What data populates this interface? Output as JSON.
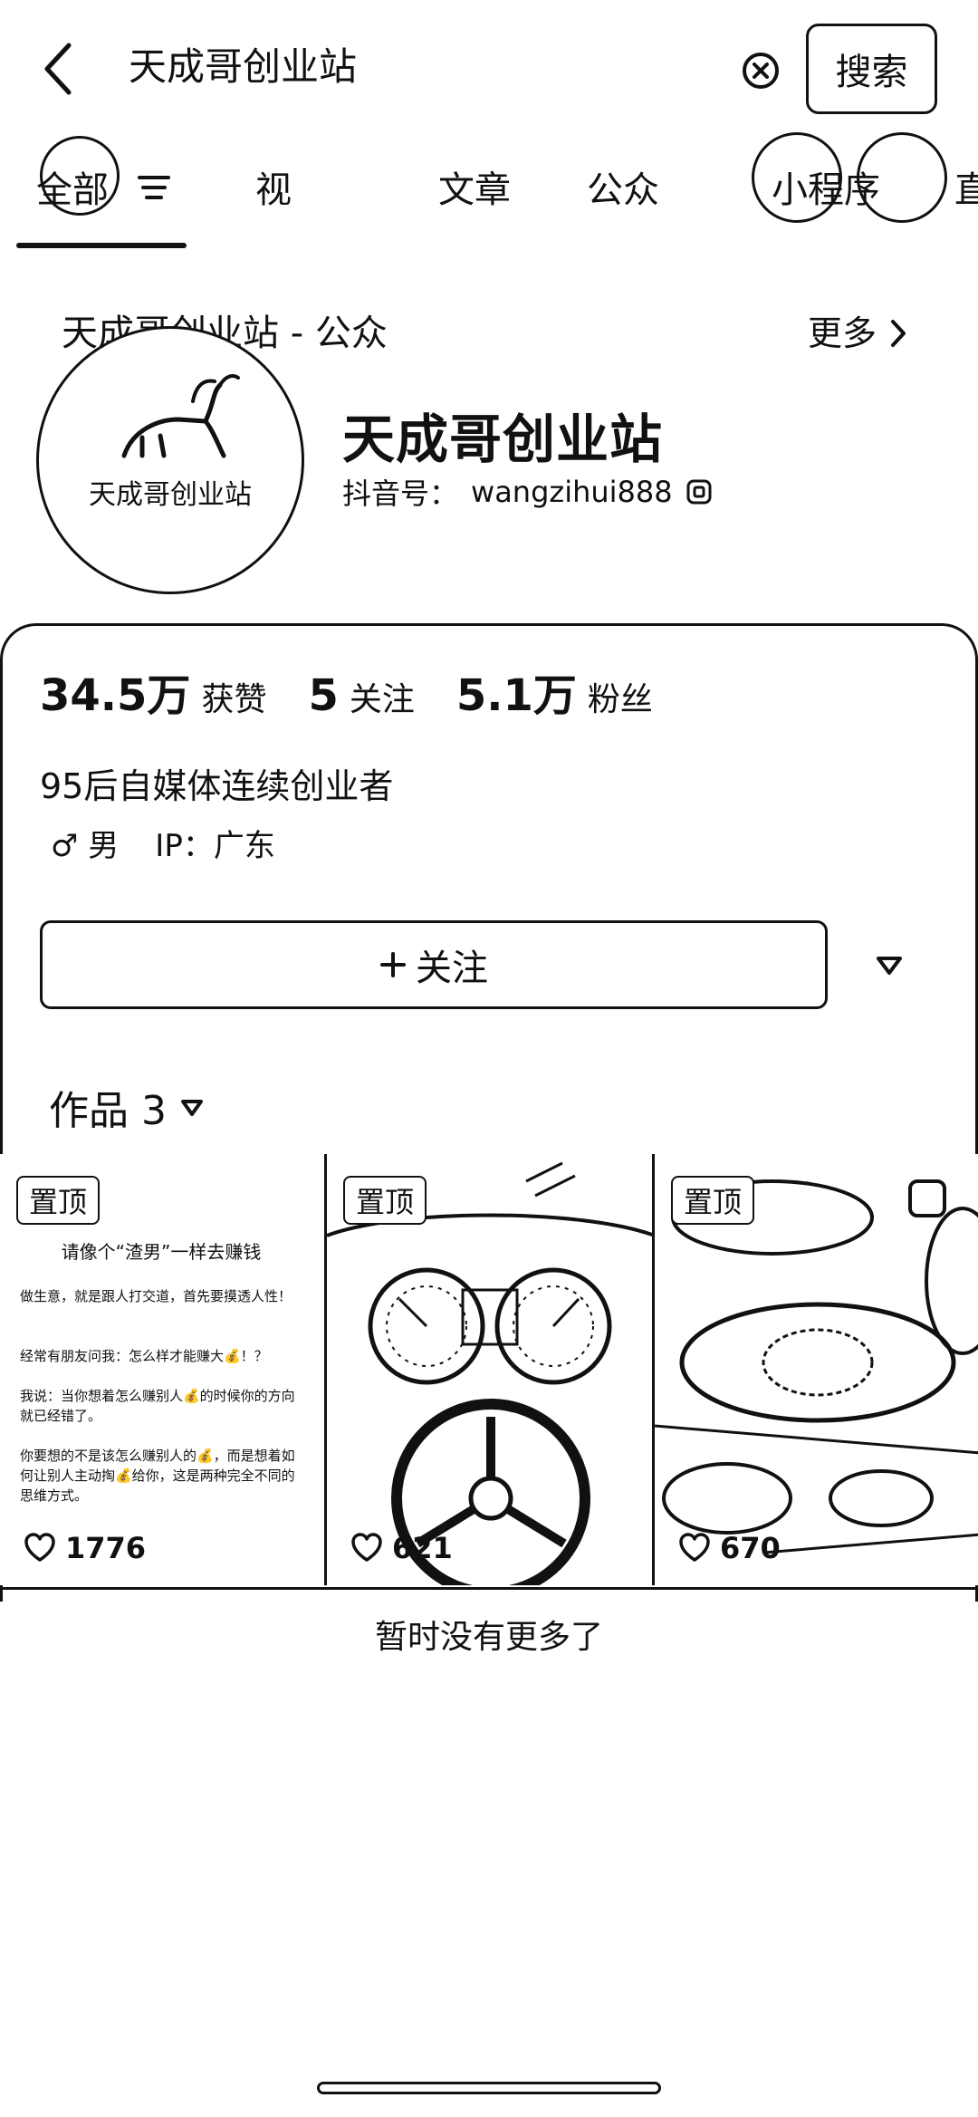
{
  "header": {
    "query": "天成哥创业站",
    "search_label": "搜索"
  },
  "tabs": [
    {
      "label": "全部"
    },
    {
      "label": "视"
    },
    {
      "label": "文章"
    },
    {
      "label": "公众"
    },
    {
      "label": "小程序"
    },
    {
      "label": "直"
    }
  ],
  "section": {
    "title": "天成哥创业站 - 公众",
    "more_label": "更多"
  },
  "profile": {
    "avatar_text": "天成哥创业站",
    "name": "天成哥创业站",
    "handle_label": "抖音号：",
    "handle_value": "wangzihui888",
    "stats": [
      {
        "value": "34.5万",
        "label": "获赞"
      },
      {
        "value": "5",
        "label": "关注"
      },
      {
        "value": "5.1万",
        "label": "粉丝"
      }
    ],
    "bio": "95后自媒体连续创业者",
    "gender": "♂ 男",
    "ip": "IP：广东",
    "follow_label": "关注"
  },
  "works": {
    "title": "作品 3",
    "items": [
      {
        "pin": "置顶",
        "likes": "1776",
        "title": "请像个“渣男”一样去赚钱",
        "paragraphs": [
          "做生意，就是跟人打交道，首先要摸透人性！",
          "经常有朋友问我：怎么样才能赚大💰！？",
          "我说：当你想着怎么赚别人💰的时候你的方向就已经错了。",
          "你要想的不是该怎么赚别人的💰，而是想着如何让别人主动掏💰给你，这是两种完全不同的思维方式。"
        ]
      },
      {
        "pin": "置顶",
        "likes": "621"
      },
      {
        "pin": "置顶",
        "likes": "670"
      }
    ]
  },
  "footer": {
    "end_note": "暂时没有更多了"
  }
}
